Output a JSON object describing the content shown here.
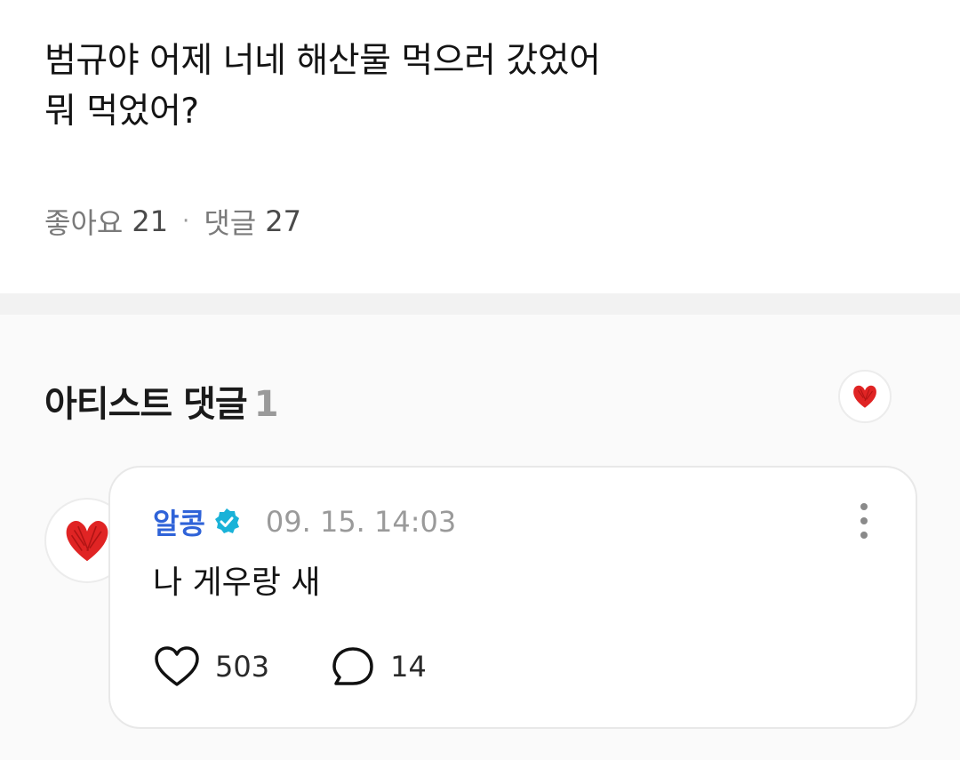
{
  "post": {
    "lines": [
      "범규야 어제 너네 해산물 먹으러 갔었어",
      "뭐 먹었어?"
    ],
    "likes_label": "좋아요",
    "likes_count": "21",
    "separator": "·",
    "comments_label": "댓글",
    "comments_count": "27"
  },
  "artist_section": {
    "title": "아티스트 댓글",
    "count": "1",
    "badge_icon": "red-heart-icon"
  },
  "comment": {
    "author": "알콩",
    "verified_icon": "verified-badge-icon",
    "timestamp": "09. 15. 14:03",
    "text": "나 게우랑 새",
    "like_count": "503",
    "reply_count": "14",
    "avatar_icon": "red-heart-icon",
    "menu_icon": "more-vertical-icon"
  },
  "colors": {
    "author_name": "#2f63d8",
    "verified": "#1ab2d8",
    "heart": "#e02424",
    "section_bg": "#fafafa",
    "divider": "#f2f2f2"
  }
}
